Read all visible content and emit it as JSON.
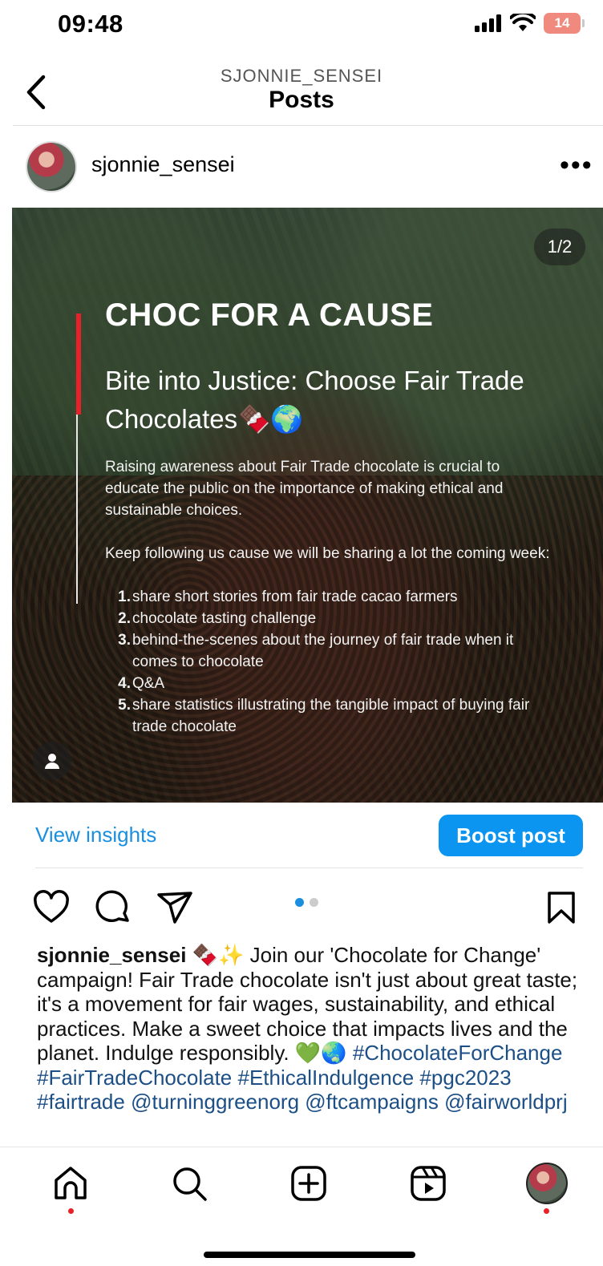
{
  "status_bar": {
    "time": "09:48",
    "battery": "14"
  },
  "header": {
    "username": "SJONNIE_SENSEI",
    "title": "Posts"
  },
  "post": {
    "username": "sjonnie_sensei",
    "more_label": "•••",
    "counter": "1/2",
    "image": {
      "title": "CHOC FOR A CAUSE",
      "subtitle": "Bite into Justice: Choose Fair Trade Chocolates🍫🌍",
      "paragraph1": "Raising awareness about Fair Trade chocolate is crucial to educate the public on the importance of making ethical and sustainable choices.",
      "paragraph2": "Keep following us cause we will be sharing a lot the coming week:",
      "list": [
        {
          "num": "1.",
          "text": "share short stories from fair trade cacao farmers"
        },
        {
          "num": "2.",
          "text": "chocolate tasting challenge"
        },
        {
          "num": "3.",
          "text": "behind-the-scenes about the journey of fair trade when it comes to chocolate"
        },
        {
          "num": "4.",
          "text": "Q&A"
        },
        {
          "num": "5.",
          "text": "share statistics illustrating the tangible impact of buying fair trade chocolate"
        }
      ]
    },
    "view_insights": "View insights",
    "boost_post": "Boost post",
    "carousel": {
      "count": 2,
      "active": 1
    },
    "caption": {
      "username": "sjonnie_sensei",
      "text": " 🍫✨ Join our 'Chocolate for Change' campaign! Fair Trade chocolate isn't just about great taste; it's a movement for fair wages, sustainability, and ethical practices. Make a sweet choice that impacts lives and the planet. Indulge responsibly. 💚🌏",
      "hashtags": "#ChocolateForChange #FairTradeChocolate #EthicalIndulgence #pgc2023 #fairtrade",
      "mentions": "@turninggreenorg @ftcampaigns @fairworldprj"
    }
  },
  "nav": {
    "items": [
      "home-icon",
      "search-icon",
      "create-icon",
      "reels-icon",
      "profile-avatar"
    ]
  },
  "colors": {
    "accent": "#0b95f0",
    "link": "#1a8fe0",
    "hashtag": "#1c4f86",
    "red": "#e8202a"
  }
}
